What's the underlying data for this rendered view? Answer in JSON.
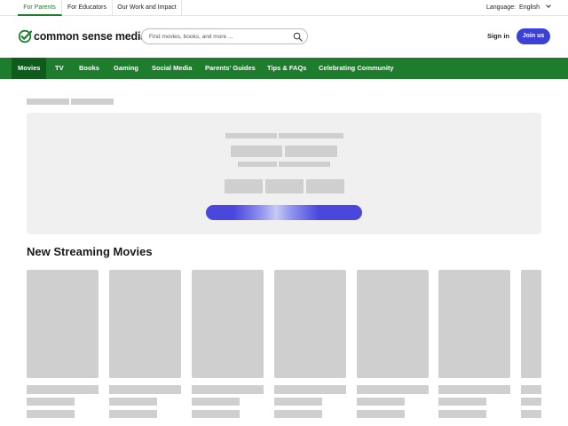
{
  "topbar": {
    "tabs": [
      {
        "label": "For Parents",
        "active": true
      },
      {
        "label": "For Educators",
        "active": false
      },
      {
        "label": "Our Work and Impact",
        "active": false
      }
    ],
    "language_label": "Language:",
    "language_value": "English"
  },
  "header": {
    "logo_text": "common sense media",
    "search_placeholder": "Find movies, books, and more ...",
    "signin_label": "Sign in",
    "join_label": "Join us"
  },
  "nav": {
    "items": [
      "Movies",
      "TV",
      "Books",
      "Gaming",
      "Social Media",
      "Parents' Guides",
      "Tips & FAQs",
      "Celebrating Community"
    ],
    "active_index": 0
  },
  "section": {
    "title": "New Streaming Movies"
  },
  "colors": {
    "brand_green": "#1e7d2d",
    "active_nav": "#0e5c1c",
    "accent_blue": "#3b40d6",
    "skeleton": "#cfcfcf"
  },
  "icons": [
    "logo-check-icon",
    "search-icon",
    "chevron-down-icon"
  ]
}
